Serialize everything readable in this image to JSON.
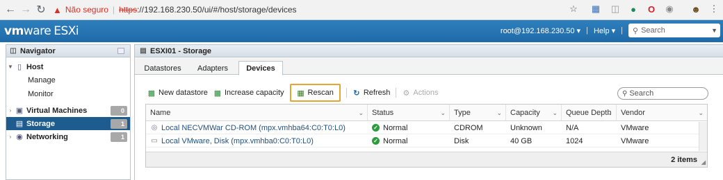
{
  "browser": {
    "back_icon": "back-arrow-icon",
    "forward_icon": "forward-arrow-icon",
    "reload_icon": "reload-icon",
    "security_label": "Não seguro",
    "url_protocol": "https",
    "url_rest": "://192.168.230.50/ui/#/host/storage/devices"
  },
  "header": {
    "brand_vm": "vm",
    "brand_ware": "ware",
    "product": "ESXi",
    "user": "root@192.168.230.50",
    "help": "Help",
    "search_placeholder": "Search"
  },
  "navigator": {
    "title": "Navigator",
    "items": [
      {
        "label": "Host",
        "expanded": true
      },
      {
        "label": "Manage"
      },
      {
        "label": "Monitor"
      },
      {
        "label": "Virtual Machines",
        "count": "0"
      },
      {
        "label": "Storage",
        "count": "1",
        "selected": true
      },
      {
        "label": "Networking",
        "count": "1"
      }
    ]
  },
  "main": {
    "title": "ESXI01 - Storage",
    "tabs": [
      {
        "label": "Datastores"
      },
      {
        "label": "Adapters"
      },
      {
        "label": "Devices",
        "active": true
      }
    ],
    "toolbar": {
      "new_datastore": "New datastore",
      "increase_capacity": "Increase capacity",
      "rescan": "Rescan",
      "refresh": "Refresh",
      "actions": "Actions"
    },
    "search_placeholder": "Search",
    "table": {
      "columns": [
        "Name",
        "Status",
        "Type",
        "Capacity",
        "Queue Depth",
        "Vendor"
      ],
      "rows": [
        {
          "name": "Local NECVMWar CD-ROM (mpx.vmhba64:C0:T0:L0)",
          "status": "Normal",
          "type": "CDROM",
          "capacity": "Unknown",
          "queue_depth": "N/A",
          "vendor": "VMware"
        },
        {
          "name": "Local VMware, Disk (mpx.vmhba0:C0:T0:L0)",
          "status": "Normal",
          "type": "Disk",
          "capacity": "40 GB",
          "queue_depth": "1024",
          "vendor": "VMware"
        }
      ],
      "footer": "2 items"
    }
  },
  "colors": {
    "header_blue": "#1f6aa8",
    "selected_nav": "#1e5b8f",
    "highlight_box": "#e6a430",
    "status_ok": "#2c9c3f",
    "insecure_red": "#d93025"
  }
}
